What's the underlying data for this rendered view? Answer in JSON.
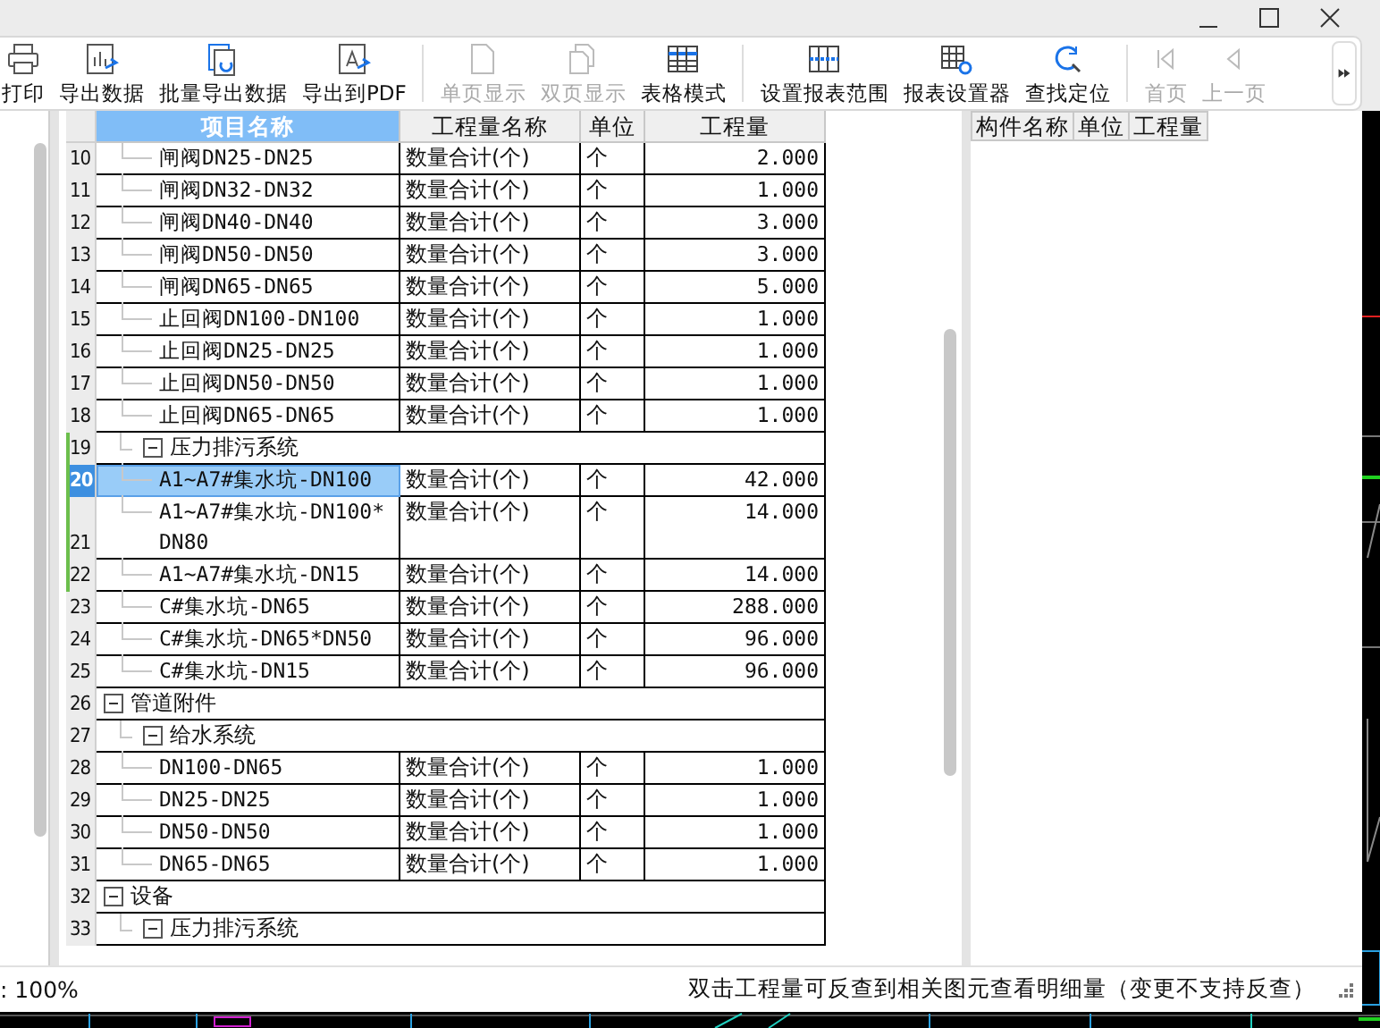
{
  "toolbar": [
    {
      "kind": "button",
      "label": "打印",
      "disabled": false
    },
    {
      "kind": "button",
      "label": "导出数据",
      "disabled": false
    },
    {
      "kind": "button",
      "label": "批量导出数据",
      "disabled": false
    },
    {
      "kind": "button",
      "label": "导出到PDF",
      "disabled": false
    },
    {
      "kind": "separator"
    },
    {
      "kind": "button",
      "label": "单页显示",
      "disabled": true
    },
    {
      "kind": "button",
      "label": "双页显示",
      "disabled": true
    },
    {
      "kind": "button",
      "label": "表格模式",
      "disabled": false
    },
    {
      "kind": "separator"
    },
    {
      "kind": "button",
      "label": "设置报表范围",
      "disabled": false
    },
    {
      "kind": "button",
      "label": "报表设置器",
      "disabled": false
    },
    {
      "kind": "button",
      "label": "查找定位",
      "disabled": false
    },
    {
      "kind": "separator"
    },
    {
      "kind": "button",
      "label": "首页",
      "disabled": true
    },
    {
      "kind": "button",
      "label": "上一页",
      "disabled": true
    }
  ],
  "table": {
    "columns": [
      "项目名称",
      "工程量名称",
      "单位",
      "工程量"
    ],
    "rows": [
      {
        "kind": "continuation",
        "children": [
          {
            "kind": "continuation",
            "children": [
              {
                "kind": "item",
                "no": "10",
                "name": "闸阀DN25-DN25",
                "qty_name": "数量合计(个)",
                "unit": "个",
                "qty": "2.000",
                "selected": false,
                "marked": false
              },
              {
                "kind": "item",
                "no": "11",
                "name": "闸阀DN32-DN32",
                "qty_name": "数量合计(个)",
                "unit": "个",
                "qty": "1.000",
                "selected": false,
                "marked": false
              },
              {
                "kind": "item",
                "no": "12",
                "name": "闸阀DN40-DN40",
                "qty_name": "数量合计(个)",
                "unit": "个",
                "qty": "3.000",
                "selected": false,
                "marked": false
              },
              {
                "kind": "item",
                "no": "13",
                "name": "闸阀DN50-DN50",
                "qty_name": "数量合计(个)",
                "unit": "个",
                "qty": "3.000",
                "selected": false,
                "marked": false
              },
              {
                "kind": "item",
                "no": "14",
                "name": "闸阀DN65-DN65",
                "qty_name": "数量合计(个)",
                "unit": "个",
                "qty": "5.000",
                "selected": false,
                "marked": false
              },
              {
                "kind": "item",
                "no": "15",
                "name": "止回阀DN100-DN100",
                "qty_name": "数量合计(个)",
                "unit": "个",
                "qty": "1.000",
                "selected": false,
                "marked": false
              },
              {
                "kind": "item",
                "no": "16",
                "name": "止回阀DN25-DN25",
                "qty_name": "数量合计(个)",
                "unit": "个",
                "qty": "1.000",
                "selected": false,
                "marked": false
              },
              {
                "kind": "item",
                "no": "17",
                "name": "止回阀DN50-DN50",
                "qty_name": "数量合计(个)",
                "unit": "个",
                "qty": "1.000",
                "selected": false,
                "marked": false
              },
              {
                "kind": "item",
                "no": "18",
                "name": "止回阀DN65-DN65",
                "qty_name": "数量合计(个)",
                "unit": "个",
                "qty": "1.000",
                "selected": false,
                "marked": false
              }
            ]
          },
          {
            "kind": "group",
            "no": "19",
            "name": "压力排污系统",
            "expanded": true,
            "selected": false,
            "marked": true,
            "children": [
              {
                "kind": "item",
                "no": "20",
                "name": "A1~A7#集水坑-DN100",
                "qty_name": "数量合计(个)",
                "unit": "个",
                "qty": "42.000",
                "selected": true,
                "marked": true
              },
              {
                "kind": "item",
                "no": "21",
                "name": "A1~A7#集水坑-DN100*DN80",
                "qty_name": "数量合计(个)",
                "unit": "个",
                "qty": "14.000",
                "selected": false,
                "marked": true
              },
              {
                "kind": "item",
                "no": "22",
                "name": "A1~A7#集水坑-DN15",
                "qty_name": "数量合计(个)",
                "unit": "个",
                "qty": "14.000",
                "selected": false,
                "marked": true
              },
              {
                "kind": "item",
                "no": "23",
                "name": "C#集水坑-DN65",
                "qty_name": "数量合计(个)",
                "unit": "个",
                "qty": "288.000",
                "selected": false,
                "marked": false
              },
              {
                "kind": "item",
                "no": "24",
                "name": "C#集水坑-DN65*DN50",
                "qty_name": "数量合计(个)",
                "unit": "个",
                "qty": "96.000",
                "selected": false,
                "marked": false
              },
              {
                "kind": "item",
                "no": "25",
                "name": "C#集水坑-DN15",
                "qty_name": "数量合计(个)",
                "unit": "个",
                "qty": "96.000",
                "selected": false,
                "marked": false
              }
            ]
          }
        ]
      },
      {
        "kind": "group",
        "no": "26",
        "name": "管道附件",
        "expanded": true,
        "selected": false,
        "marked": false,
        "children": [
          {
            "kind": "group",
            "no": "27",
            "name": "给水系统",
            "expanded": true,
            "selected": false,
            "marked": false,
            "children": [
              {
                "kind": "item",
                "no": "28",
                "name": "DN100-DN65",
                "qty_name": "数量合计(个)",
                "unit": "个",
                "qty": "1.000",
                "selected": false,
                "marked": false
              },
              {
                "kind": "item",
                "no": "29",
                "name": "DN25-DN25",
                "qty_name": "数量合计(个)",
                "unit": "个",
                "qty": "1.000",
                "selected": false,
                "marked": false
              },
              {
                "kind": "item",
                "no": "30",
                "name": "DN50-DN50",
                "qty_name": "数量合计(个)",
                "unit": "个",
                "qty": "1.000",
                "selected": false,
                "marked": false
              },
              {
                "kind": "item",
                "no": "31",
                "name": "DN65-DN65",
                "qty_name": "数量合计(个)",
                "unit": "个",
                "qty": "1.000",
                "selected": false,
                "marked": false
              }
            ]
          }
        ]
      },
      {
        "kind": "group",
        "no": "32",
        "name": "设备",
        "expanded": true,
        "selected": false,
        "marked": false,
        "children": [
          {
            "kind": "group",
            "no": "33",
            "name": "压力排污系统",
            "expanded": true,
            "selected": false,
            "marked": false
          }
        ]
      }
    ]
  },
  "detail_table": {
    "columns": [
      "构件名称",
      "单位",
      "工程量"
    ]
  },
  "status_bar": {
    "zoom": ": 100%",
    "hint": "双击工程量可反查到相关图元查看明细量（变更不支持反查）"
  }
}
